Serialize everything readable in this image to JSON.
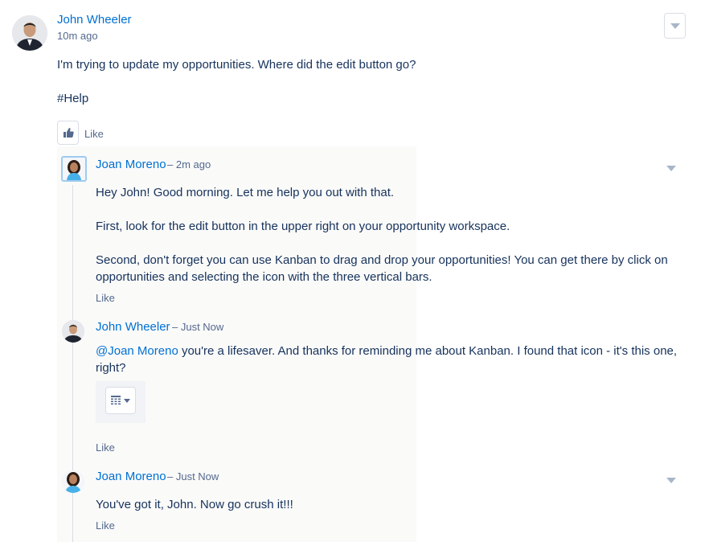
{
  "post": {
    "author": "John Wheeler",
    "time": "10m ago",
    "body": "I'm trying to update my opportunities. Where did the edit button go?",
    "tag": "#Help",
    "like_label": "Like",
    "like_icon": "thumbs-up-icon",
    "menu_icon": "chevron-down-icon"
  },
  "comments": [
    {
      "author": "Joan Moreno",
      "time": "– 2m ago",
      "paragraphs": [
        "Hey John! Good morning. Let me help you out with that.",
        "First, look for the edit button in the upper right on your opportunity workspace.",
        "Second, don't forget you can use Kanban to drag and drop your opportunities! You can get there by click on opportunities and selecting the icon with the three vertical bars."
      ],
      "like_label": "Like"
    },
    {
      "author": "John Wheeler",
      "time": "– Just Now",
      "mention": "@Joan Moreno",
      "text": " you're a lifesaver. And thanks for reminding me about Kanban. I found that icon - it's this one, right?",
      "attachment_icon": "table-grid-icon",
      "like_label": "Like"
    },
    {
      "author": "Joan Moreno",
      "time": "– Just Now",
      "text": "You've got it, John. Now go crush it!!!",
      "like_label": "Like"
    }
  ],
  "colors": {
    "link": "#0070d2",
    "text": "#16325c",
    "muted": "#54698d",
    "border": "#d8dde6",
    "thread_bg": "#fafaf9"
  }
}
